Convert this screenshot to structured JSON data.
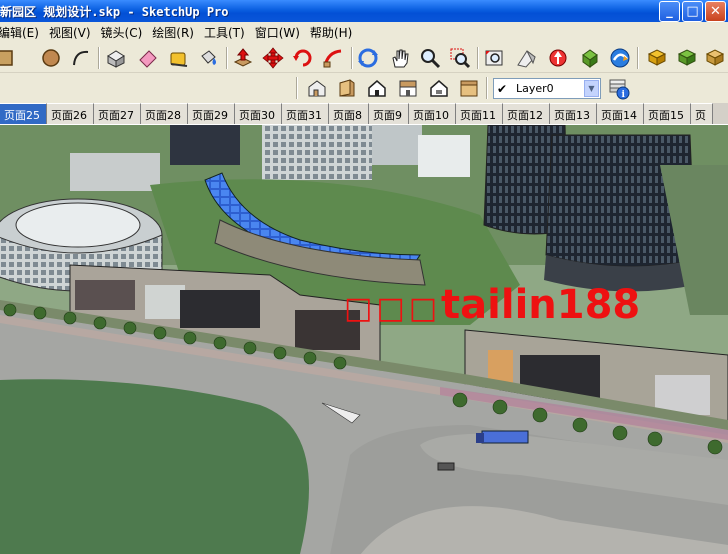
{
  "window": {
    "title": "新园区 规划设计.skp - SketchUp Pro",
    "buttons": {
      "minimize": "_",
      "maximize": "□",
      "close": "✕"
    }
  },
  "menu": [
    {
      "label": "编辑(E)"
    },
    {
      "label": "视图(V)"
    },
    {
      "label": "镜头(C)"
    },
    {
      "label": "绘图(R)"
    },
    {
      "label": "工具(T)"
    },
    {
      "label": "窗口(W)"
    },
    {
      "label": "帮助(H)"
    }
  ],
  "layer_select": {
    "value": "Layer0",
    "check": "✔",
    "arrow": "▼"
  },
  "tabs": [
    {
      "label": "页面25",
      "active": true
    },
    {
      "label": "页面26"
    },
    {
      "label": "页面27"
    },
    {
      "label": "页面28"
    },
    {
      "label": "页面29"
    },
    {
      "label": "页面30"
    },
    {
      "label": "页面31"
    },
    {
      "label": "页面8"
    },
    {
      "label": "页面9"
    },
    {
      "label": "页面10"
    },
    {
      "label": "页面11"
    },
    {
      "label": "页面12"
    },
    {
      "label": "页面13"
    },
    {
      "label": "页面14"
    },
    {
      "label": "页面15"
    },
    {
      "label": "页"
    }
  ],
  "watermark": {
    "boxes": "□□□",
    "text": "tailin188"
  },
  "icons": {
    "toolbar1": [
      "rectangle-icon",
      "circle-icon",
      "arc-icon",
      "make-component-icon",
      "eraser-icon",
      "tape-measure-icon",
      "paint-bucket-icon",
      "push-pull-icon",
      "move-icon",
      "rotate-icon",
      "follow-me-icon",
      "orbit-icon",
      "pan-icon",
      "zoom-icon",
      "zoom-window-icon",
      "zoom-extents-icon",
      "previous-view-icon",
      "next-view-icon",
      "get-models-icon",
      "share-model-icon",
      "warehouse-icon"
    ],
    "toolbar2": [
      "iso-view-icon",
      "top-view-icon",
      "front-view-icon",
      "right-view-icon",
      "back-view-icon",
      "left-view-icon",
      "layer-manager-icon"
    ]
  },
  "colors": {
    "titlebar": "#0A5FE0",
    "active_tab": "#316AC5",
    "watermark": "#EE1111"
  }
}
